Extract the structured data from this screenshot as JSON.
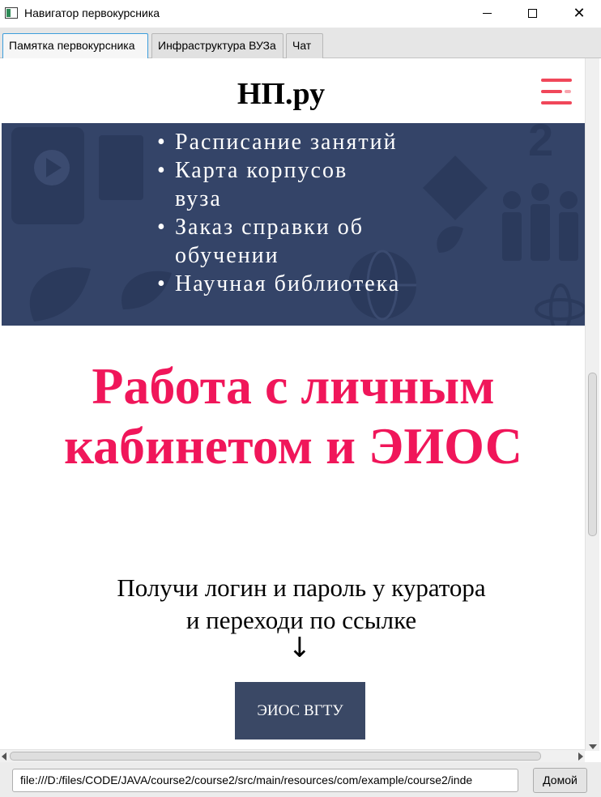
{
  "window": {
    "title": "Навигатор первокурсника",
    "minimize_icon": "minimize-icon",
    "maximize_icon": "maximize-icon",
    "close_icon": "close-icon",
    "close_glyph": "✕"
  },
  "tabs": [
    {
      "label": "Памятка первокурсника",
      "active": true
    },
    {
      "label": "Инфраструктура ВУЗа",
      "active": false
    },
    {
      "label": "Чат",
      "active": false
    }
  ],
  "site": {
    "logo": "НП.ру",
    "menu_icon": "hamburger-menu-icon",
    "accent_color": "#f0165a",
    "hero_color": "#344468",
    "hero_items": [
      "Расписание занятий",
      "Карта корпусов вуза",
      "Заказ справки об обучении",
      "Научная библиотека"
    ],
    "section_title": "Работа с личным кабинетом и ЭИОС",
    "section_subtitle_line1": "Получи логин и пароль у куратора",
    "section_subtitle_line2": "и переходи по ссылке",
    "arrow": "↓",
    "cta_label": "ЭИОС ВГТУ"
  },
  "address_bar": {
    "url": "file:///D:/files/CODE/JAVA/course2/course2/src/main/resources/com/example/course2/inde",
    "home_label": "Домой"
  }
}
